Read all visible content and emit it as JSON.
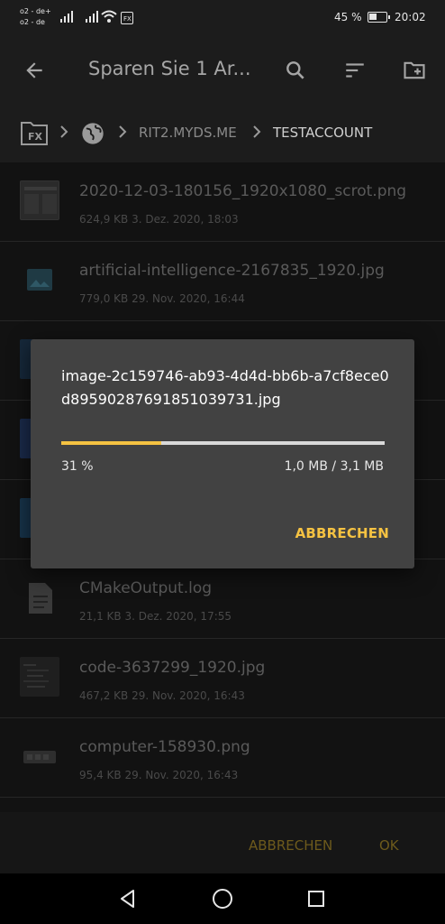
{
  "status_bar": {
    "carrier1": "o2 - de+",
    "carrier2": "o2 - de",
    "battery_percent": "45 %",
    "battery_level": 0.45,
    "time": "20:02",
    "icons": [
      "signal-icon",
      "signal-icon",
      "wifi-icon",
      "app-notification-icon",
      "battery-icon"
    ]
  },
  "toolbar": {
    "title": "Sparen Sie 1 Ar...",
    "icons": [
      "back-arrow-icon",
      "search-icon",
      "sort-icon",
      "new-folder-icon"
    ]
  },
  "breadcrumb": {
    "items": [
      "RIT2.MYDS.ME",
      "TESTACCOUNT"
    ],
    "icons": [
      "fx-folder-icon",
      "globe-icon",
      "chevron-right-icon"
    ]
  },
  "files": [
    {
      "name": "2020-12-03-180156_1920x1080_scrot.png",
      "meta": "624,9 KB   3. Dez. 2020, 18:03",
      "thumb": "screenshot-thumbnail"
    },
    {
      "name": "artificial-intelligence-2167835_1920.jpg",
      "meta": "779,0 KB   29. Nov. 2020, 16:44",
      "thumb": "image-icon"
    },
    {
      "name": "",
      "meta": "",
      "thumb": "blue-thumbnail"
    },
    {
      "name": "",
      "meta": "",
      "thumb": "blue-thumbnail"
    },
    {
      "name": "",
      "meta": "",
      "thumb": "blue-thumbnail"
    },
    {
      "name": "CMakeOutput.log",
      "meta": "21,1 KB   3. Dez. 2020, 17:55",
      "thumb": "document-icon"
    },
    {
      "name": "code-3637299_1920.jpg",
      "meta": "467,2 KB   29. Nov. 2020, 16:43",
      "thumb": "code-thumbnail"
    },
    {
      "name": "computer-158930.png",
      "meta": "95,4 KB   29. Nov. 2020, 16:43",
      "thumb": "computer-thumbnail"
    }
  ],
  "bottom_bar": {
    "cancel_label": "ABBRECHEN",
    "ok_label": "OK"
  },
  "dialog": {
    "filename": "image-2c159746-ab93-4d4d-bb6b-a7cf8ece0d89590287691851039731.jpg",
    "progress_fraction": 0.31,
    "percent_label": "31 %",
    "size_label": "1,0 MB / 3,1 MB",
    "cancel_label": "ABBRECHEN"
  },
  "nav_bar": {
    "icons": [
      "back-triangle-icon",
      "home-circle-icon",
      "recents-square-icon"
    ]
  },
  "colors": {
    "accent": "#f5c242",
    "dialog_bg": "#424242",
    "toolbar_bg": "#1c1c1c"
  }
}
